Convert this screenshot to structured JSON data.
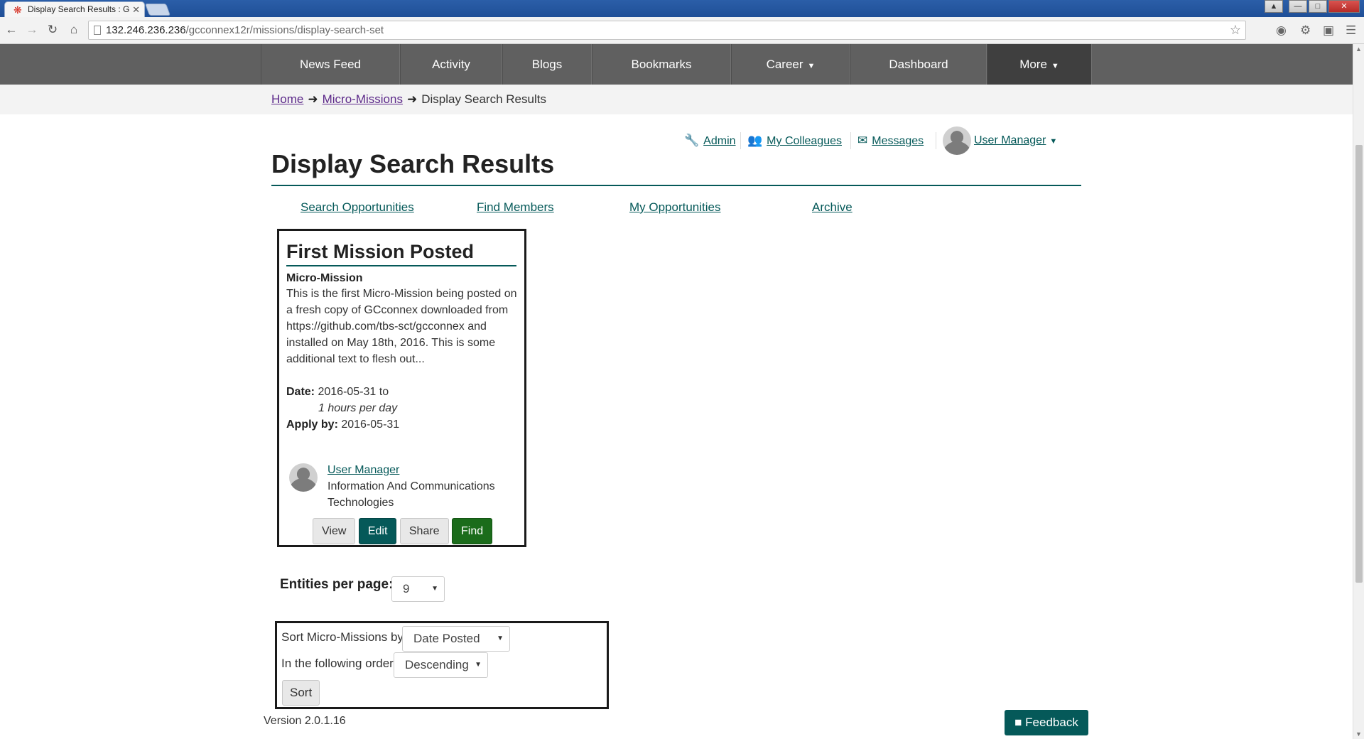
{
  "browser": {
    "tab_title": "Display Search Results : G",
    "url_host": "132.246.236.236",
    "url_path": "/gcconnex12r/missions/display-search-set"
  },
  "nav": {
    "items": [
      {
        "label": "News Feed"
      },
      {
        "label": "Activity"
      },
      {
        "label": "Blogs"
      },
      {
        "label": "Bookmarks"
      },
      {
        "label": "Career"
      },
      {
        "label": "Dashboard"
      },
      {
        "label": "More"
      }
    ]
  },
  "breadcrumb": {
    "home": "Home",
    "missions": "Micro-Missions",
    "current": "Display Search Results"
  },
  "user_menu": {
    "admin": "Admin",
    "colleagues": "My Colleagues",
    "messages": "Messages",
    "user": "User Manager"
  },
  "page": {
    "title": "Display Search Results"
  },
  "subnav": {
    "search": "Search Opportunities",
    "members": "Find Members",
    "mine": "My Opportunities",
    "archive": "Archive"
  },
  "mission": {
    "title": "First Mission Posted",
    "type": "Micro-Mission",
    "description": "This is the first Micro-Mission being posted on a fresh copy of GCconnex downloaded from https://github.com/tbs-sct/gcconnex and installed on May 18th, 2016. This is some additional text to flesh out...",
    "date_label": "Date:",
    "date_value": "2016-05-31 to",
    "hours": "1 hours per day",
    "apply_label": "Apply by:",
    "apply_value": "2016-05-31",
    "owner_name": "User Manager",
    "owner_dept": "Information And Communications Technologies",
    "actions": {
      "view": "View",
      "edit": "Edit",
      "share": "Share",
      "find": "Find"
    }
  },
  "pagination": {
    "label": "Entities per page:",
    "value": "9"
  },
  "sort": {
    "by_label": "Sort Micro-Missions by:",
    "by_value": "Date Posted",
    "order_label": "In the following order:",
    "order_value": "Descending",
    "button": "Sort"
  },
  "footer": {
    "version": "Version 2.0.1.16",
    "feedback": "Feedback"
  },
  "colors": {
    "accent": "#055959",
    "nav_bg": "#606060",
    "find_green": "#1b6c1b"
  },
  "icons": [
    "canada-leaf-icon",
    "back-icon",
    "forward-icon",
    "reload-icon",
    "home-icon",
    "star-icon",
    "wrench-icon",
    "users-icon",
    "envelope-icon",
    "chevron-down-icon",
    "comment-icon"
  ]
}
